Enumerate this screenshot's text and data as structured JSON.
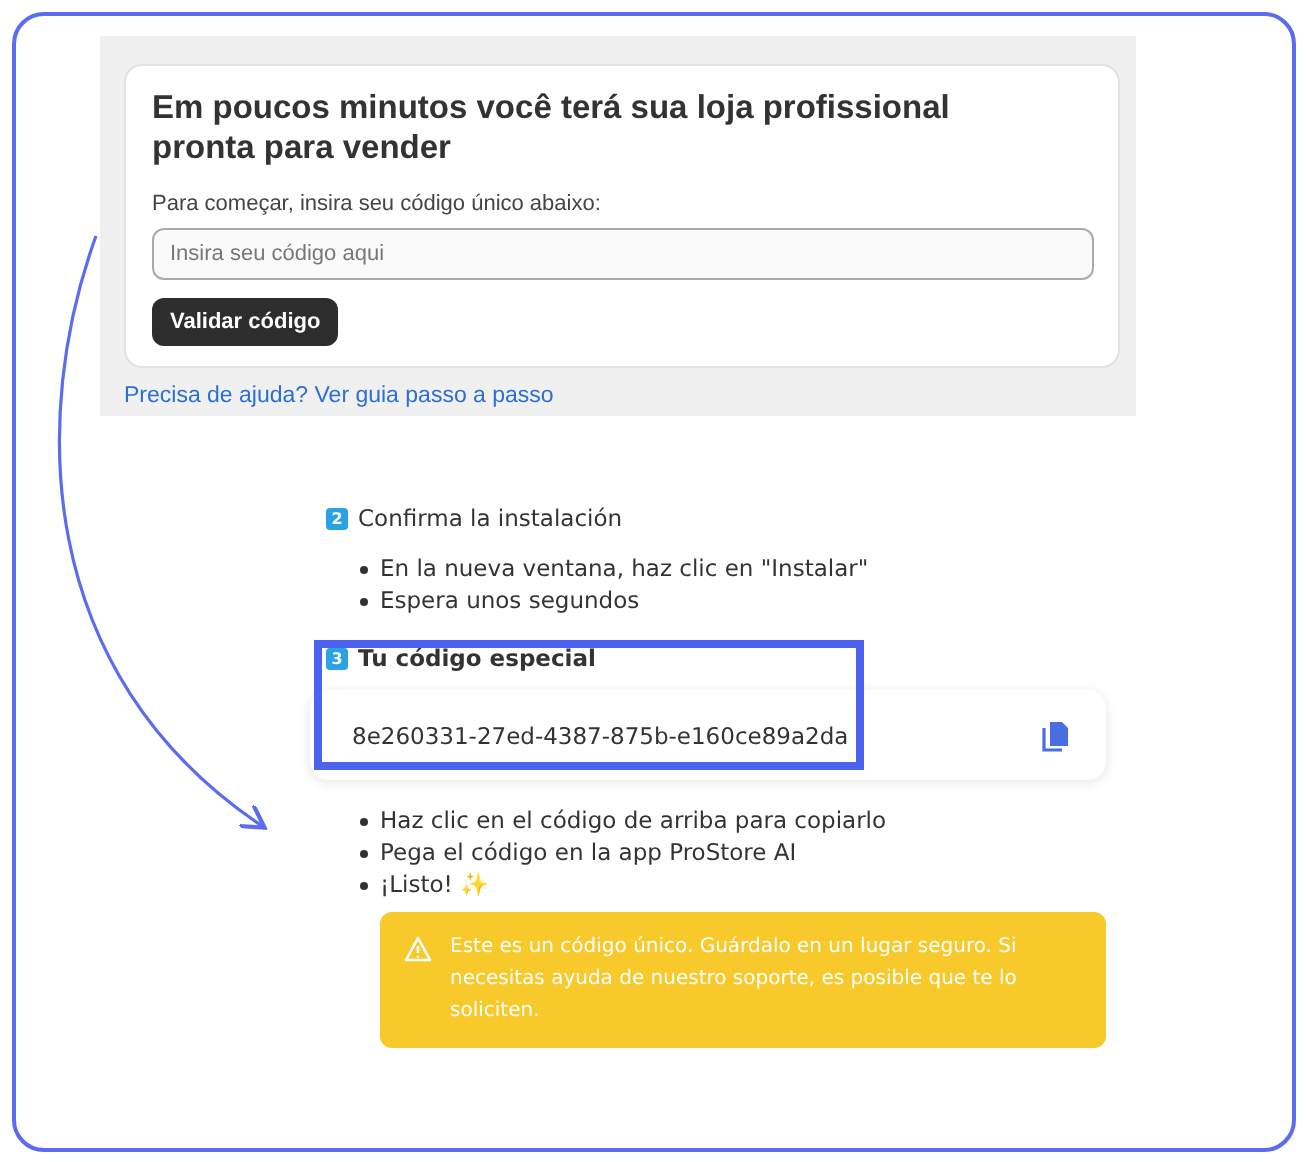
{
  "signup_panel": {
    "heading": "Em poucos minutos você terá sua loja profissional pronta para vender",
    "field_label": "Para começar, insira seu código único abaixo:",
    "code_field": {
      "placeholder": "Insira seu código aqui"
    },
    "button": "Validar código",
    "help_link": "Precisa de ajuda? Ver guia passo a passo"
  },
  "steps": [
    {
      "number": "2",
      "title": "Confirma la instalación",
      "emphasized": false,
      "bullets": [
        "En la nueva ventana, haz clic en \"Instalar\"",
        "Espera unos segundos"
      ]
    },
    {
      "number": "3",
      "title": "Tu código especial",
      "emphasized": true,
      "code": "8e260331-27ed-4387-875b-e160ce89a2da",
      "bullets": [
        "Haz clic en el código de arriba para copiarlo",
        "Pega el código en la app ProStore AI",
        "¡Listo! ✨"
      ],
      "warning": "Este es un código único. Guárdalo en un lugar seguro. Si necesitas ayuda de nuestro soporte, es posible que te lo soliciten."
    }
  ]
}
